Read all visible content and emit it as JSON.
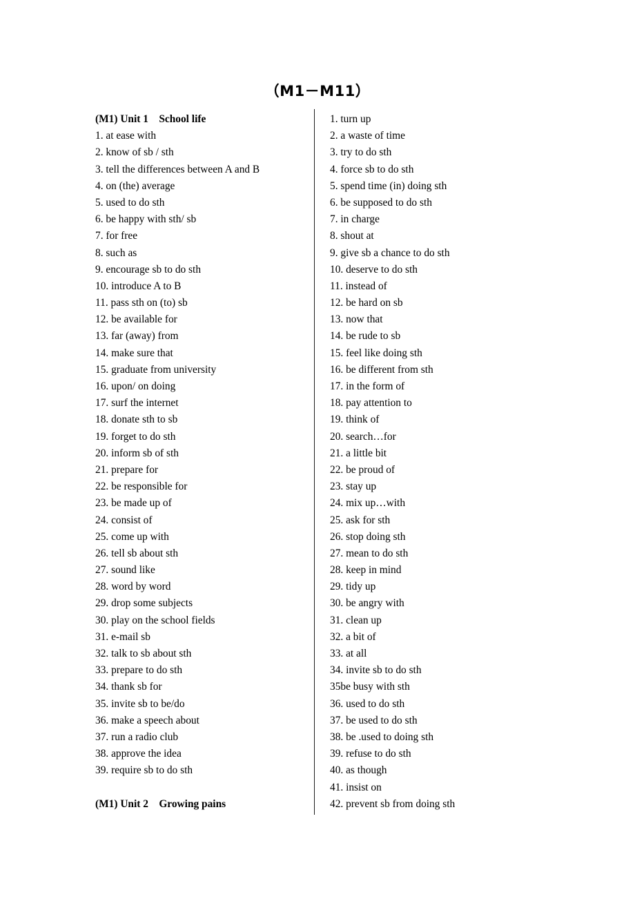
{
  "document": {
    "title": "（M1－M11）"
  },
  "columns": {
    "left": {
      "entries": [
        {
          "text": "(M1) Unit 1    School life",
          "bold": true
        },
        {
          "text": "1. at ease with",
          "bold": false
        },
        {
          "text": "2. know of sb / sth",
          "bold": false
        },
        {
          "text": "3. tell the differences between A and B",
          "bold": false
        },
        {
          "text": "4. on (the) average",
          "bold": false
        },
        {
          "text": "5. used to do sth",
          "bold": false
        },
        {
          "text": "6. be happy with sth/ sb",
          "bold": false
        },
        {
          "text": "7. for free",
          "bold": false
        },
        {
          "text": "8. such as",
          "bold": false
        },
        {
          "text": "9. encourage sb to do sth",
          "bold": false
        },
        {
          "text": "10. introduce A to B",
          "bold": false
        },
        {
          "text": "11. pass sth on (to) sb",
          "bold": false
        },
        {
          "text": "12. be available for",
          "bold": false
        },
        {
          "text": "13. far (away) from",
          "bold": false
        },
        {
          "text": "14. make sure that",
          "bold": false
        },
        {
          "text": "15. graduate from university",
          "bold": false
        },
        {
          "text": "16. upon/ on doing",
          "bold": false
        },
        {
          "text": "17. surf the internet",
          "bold": false
        },
        {
          "text": "18. donate sth to sb",
          "bold": false
        },
        {
          "text": "19. forget to do sth",
          "bold": false
        },
        {
          "text": "20. inform sb of sth",
          "bold": false
        },
        {
          "text": "21. prepare for",
          "bold": false
        },
        {
          "text": "22. be responsible for",
          "bold": false
        },
        {
          "text": "23. be made up of",
          "bold": false
        },
        {
          "text": "24. consist of",
          "bold": false
        },
        {
          "text": "25. come up with",
          "bold": false
        },
        {
          "text": "26. tell sb about sth",
          "bold": false
        },
        {
          "text": "27. sound like",
          "bold": false
        },
        {
          "text": "28. word by word",
          "bold": false
        },
        {
          "text": "29. drop some subjects",
          "bold": false
        },
        {
          "text": "30. play on the school fields",
          "bold": false
        },
        {
          "text": "31. e-mail sb",
          "bold": false
        },
        {
          "text": "32. talk to sb about sth",
          "bold": false
        },
        {
          "text": "33. prepare to do sth",
          "bold": false
        },
        {
          "text": "34. thank sb for",
          "bold": false
        },
        {
          "text": "35. invite sb to be/do",
          "bold": false
        },
        {
          "text": "36. make a speech about",
          "bold": false
        },
        {
          "text": "37. run a radio club",
          "bold": false
        },
        {
          "text": "38. approve the idea",
          "bold": false
        },
        {
          "text": "39. require sb to do sth",
          "bold": false
        },
        {
          "text": "",
          "bold": false
        },
        {
          "text": "(M1) Unit 2    Growing pains",
          "bold": true
        }
      ]
    },
    "right": {
      "entries": [
        {
          "text": "1. turn up",
          "bold": false
        },
        {
          "text": "2. a waste of time",
          "bold": false
        },
        {
          "text": "3. try to do sth",
          "bold": false
        },
        {
          "text": "4. force sb to do sth",
          "bold": false
        },
        {
          "text": "5. spend time (in) doing sth",
          "bold": false
        },
        {
          "text": "6. be supposed to do sth",
          "bold": false
        },
        {
          "text": "7. in charge",
          "bold": false
        },
        {
          "text": "8. shout at",
          "bold": false
        },
        {
          "text": "9. give sb a chance to do sth",
          "bold": false
        },
        {
          "text": "10. deserve to do sth",
          "bold": false
        },
        {
          "text": "11. instead of",
          "bold": false
        },
        {
          "text": "12. be hard on sb",
          "bold": false
        },
        {
          "text": "13. now that",
          "bold": false
        },
        {
          "text": "14. be rude to sb",
          "bold": false
        },
        {
          "text": "15. feel like doing sth",
          "bold": false
        },
        {
          "text": "16. be different from sth",
          "bold": false
        },
        {
          "text": "17. in the form of",
          "bold": false
        },
        {
          "text": "18. pay attention to",
          "bold": false
        },
        {
          "text": "19. think of",
          "bold": false
        },
        {
          "text": "20. search…for",
          "bold": false
        },
        {
          "text": "21. a little bit",
          "bold": false
        },
        {
          "text": "22. be proud of",
          "bold": false
        },
        {
          "text": "23. stay up",
          "bold": false
        },
        {
          "text": "24. mix up…with",
          "bold": false
        },
        {
          "text": "25. ask for sth",
          "bold": false
        },
        {
          "text": "26. stop doing sth",
          "bold": false
        },
        {
          "text": "27. mean to do sth",
          "bold": false
        },
        {
          "text": "28. keep in mind",
          "bold": false
        },
        {
          "text": "29. tidy up",
          "bold": false
        },
        {
          "text": "30. be angry with",
          "bold": false
        },
        {
          "text": "31. clean up",
          "bold": false
        },
        {
          "text": "32. a bit of",
          "bold": false
        },
        {
          "text": "33. at all",
          "bold": false
        },
        {
          "text": "34. invite sb to do sth",
          "bold": false
        },
        {
          "text": "35be busy with sth",
          "bold": false
        },
        {
          "text": "36. used to do sth",
          "bold": false
        },
        {
          "text": "37. be used to do sth",
          "bold": false
        },
        {
          "text": "38. be .used to doing sth",
          "bold": false
        },
        {
          "text": "39. refuse to do sth",
          "bold": false
        },
        {
          "text": "40. as though",
          "bold": false
        },
        {
          "text": "41. insist on",
          "bold": false
        },
        {
          "text": "42. prevent sb from doing sth",
          "bold": false
        }
      ]
    }
  }
}
